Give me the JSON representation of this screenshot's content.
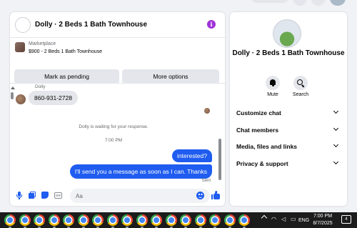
{
  "chat": {
    "title": "Dolly · 2 Beds 1 Bath Townhouse",
    "listing": {
      "source": "Marketplace",
      "description": "$900 - 2 Beds 1 Bath Townhouse"
    },
    "buttons": {
      "mark_pending": "Mark as pending",
      "more_options": "More options"
    },
    "messages": {
      "sender_name": "Dolly",
      "incoming_text": "860-931-2728",
      "waiting_notice": "Dolly is waiting for your response.",
      "timestamp": "7:00 PM",
      "outgoing_1": "interested?",
      "outgoing_2": "I'll send you a message as soon as I can. Thanks",
      "status": "Sent"
    },
    "composer": {
      "placeholder": "Aa",
      "gif_label": "GIF"
    },
    "icons": {
      "info": "info-icon",
      "mic": "microphone-icon",
      "photo": "photo-icon",
      "sticker": "sticker-icon",
      "gif": "gif-icon",
      "emoji": "emoji-icon",
      "like": "thumbs-up-icon"
    },
    "accent_color": "#1f5cf0"
  },
  "panel": {
    "title": "Dolly · 2 Beds 1 Bath Townhouse",
    "actions": [
      {
        "label": "Mute",
        "icon": "bell-icon"
      },
      {
        "label": "Search",
        "icon": "search-icon"
      }
    ],
    "menu": [
      {
        "label": "Customize chat"
      },
      {
        "label": "Chat members"
      },
      {
        "label": "Media, files and links"
      },
      {
        "label": "Privacy & support"
      }
    ]
  },
  "taskbar": {
    "app_icon": "chrome-icon",
    "app_count": 17,
    "language": "ENG",
    "time": "7:00 PM",
    "date": "8/7/2025",
    "notifications": "4"
  }
}
